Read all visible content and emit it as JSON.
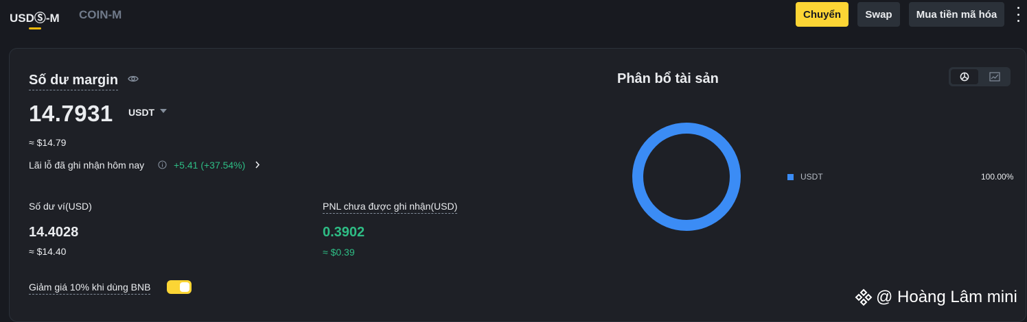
{
  "tabs": [
    {
      "label": "USDⓈ-M",
      "active": true
    },
    {
      "label": "COIN-M",
      "active": false
    }
  ],
  "actions": {
    "transfer": "Chuyển",
    "swap": "Swap",
    "buy_crypto": "Mua tiền mã hóa"
  },
  "margin": {
    "title": "Số dư margin",
    "value": "14.7931",
    "unit": "USDT",
    "approx": "≈ $14.79",
    "pnl_today_label": "Lãi lỗ đã ghi nhận hôm nay",
    "pnl_today_value": "+5.41 (+37.54%)"
  },
  "wallet": {
    "label": "Số dư ví(USD)",
    "value": "14.4028",
    "approx": "≈ $14.40"
  },
  "unrealized": {
    "label": "PNL chưa được ghi nhận(USD)",
    "value": "0.3902",
    "approx": "≈ $0.39"
  },
  "bnb_discount": {
    "label": "Giảm giá 10% khi dùng BNB",
    "enabled": true
  },
  "allocation": {
    "title": "Phân bổ tài sản",
    "legend": [
      {
        "name": "USDT",
        "percent": "100.00%",
        "color": "#3b8cf5"
      }
    ]
  },
  "watermark": {
    "text": "@ Hoàng Lâm mini"
  },
  "colors": {
    "accent": "#fcd535",
    "positive": "#2ebd85",
    "donut": "#3b8cf5"
  }
}
